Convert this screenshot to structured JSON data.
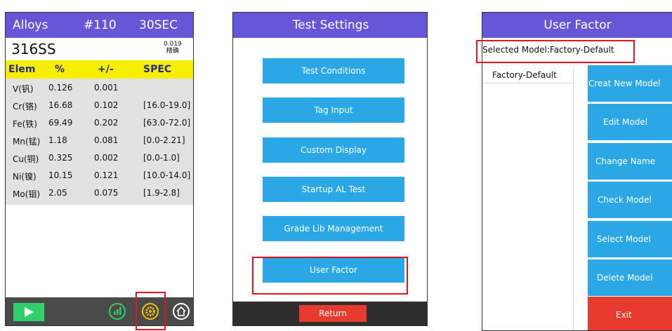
{
  "analyzer": {
    "header": {
      "title": "Alloys",
      "number": "#110",
      "time": "30SEC"
    },
    "alloy": {
      "name": "316SS",
      "value": "0.019",
      "match": "精确"
    },
    "columns": [
      "Elem",
      "%",
      "+/-",
      "SPEC"
    ],
    "rows": [
      {
        "elem": "V(钒)",
        "pct": "0.126",
        "err": "0.001",
        "spec": ""
      },
      {
        "elem": "Cr(铬)",
        "pct": "16.68",
        "err": "0.102",
        "spec": "[16.0-19.0]"
      },
      {
        "elem": "Fe(铁)",
        "pct": "69.49",
        "err": "0.202",
        "spec": "[63.0-72.0]"
      },
      {
        "elem": "Mn(锰)",
        "pct": "1.18",
        "err": "0.081",
        "spec": "[0.0-2.21]"
      },
      {
        "elem": "Cu(铜)",
        "pct": "0.325",
        "err": "0.002",
        "spec": "[0.0-1.0]"
      },
      {
        "elem": "Ni(镍)",
        "pct": "10.15",
        "err": "0.121",
        "spec": "[10.0-14.0]"
      },
      {
        "elem": "Mo(钼)",
        "pct": "2.05",
        "err": "0.075",
        "spec": "[1.9-2.8]"
      }
    ],
    "footer_icons": [
      "play-icon",
      "chart-icon",
      "gear-icon",
      "home-icon"
    ]
  },
  "test_settings": {
    "title": "Test Settings",
    "buttons": [
      "Test Conditions",
      "Tag Input",
      "Custom Display",
      "Startup AL Test",
      "Grade Lib Management",
      "User Factor"
    ],
    "return_label": "Return"
  },
  "user_factor": {
    "title": "User Factor",
    "selected_model": "Selected Model:Factory-Default",
    "models": [
      "Factory-Default"
    ],
    "buttons": [
      "Creat New Model",
      "Edit Model",
      "Change Name",
      "Check Model",
      "Select Model",
      "Delete Model"
    ],
    "exit_label": "Exit"
  },
  "colors": {
    "header": "#6657d8",
    "column_bar": "#f5f000",
    "button_blue": "#2aa8e6",
    "button_red": "#e63b2e",
    "highlight_box": "#e0151f"
  }
}
